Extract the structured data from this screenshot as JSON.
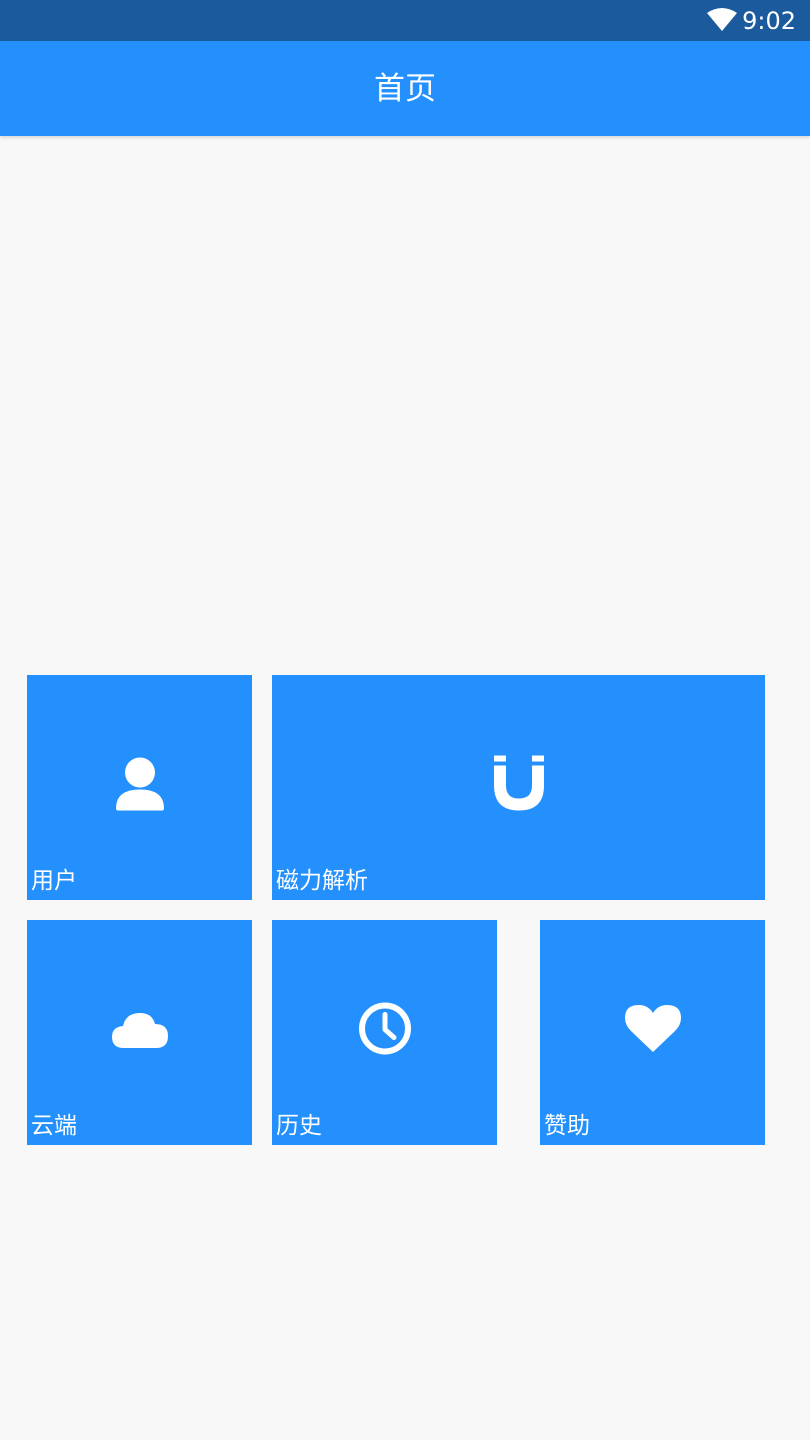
{
  "status_bar": {
    "time": "9:02",
    "wifi_icon": "wifi-icon"
  },
  "app_bar": {
    "title": "首页"
  },
  "tiles": [
    {
      "label": "用户",
      "icon": "user-icon"
    },
    {
      "label": "磁力解析",
      "icon": "magnet-icon"
    },
    {
      "label": "云端",
      "icon": "cloud-icon"
    },
    {
      "label": "历史",
      "icon": "clock-icon"
    },
    {
      "label": "赞助",
      "icon": "heart-icon"
    }
  ],
  "colors": {
    "status_bar": "#1b5a9c",
    "app_bar": "#2490fd",
    "tile": "#2490fd",
    "background": "#f8f8f8",
    "foreground": "#ffffff"
  }
}
